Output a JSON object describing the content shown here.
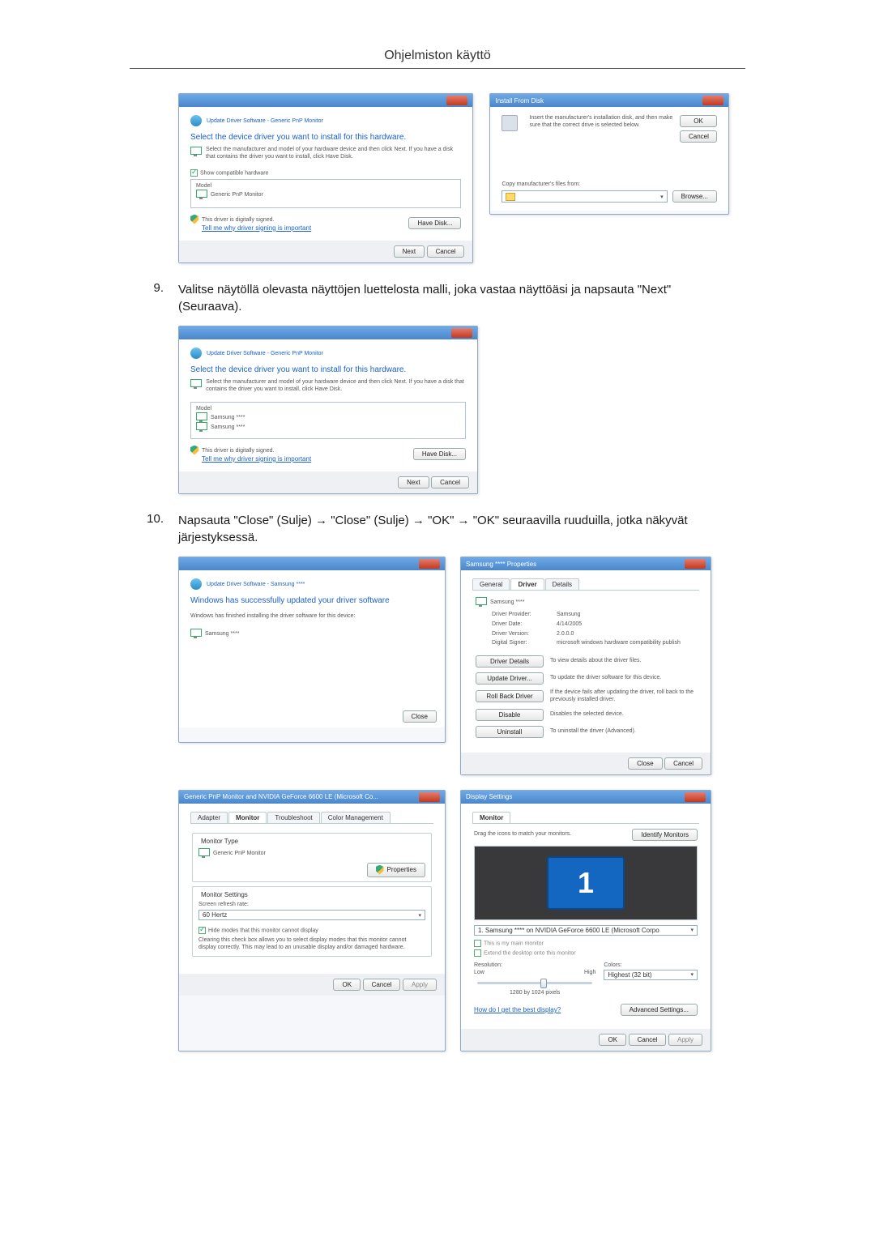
{
  "page_title": "Ohjelmiston käyttö",
  "steps": {
    "s9_num": "9.",
    "s9_text": "Valitse näytöllä olevasta näyttöjen luettelosta malli, joka vastaa näyttöäsi ja napsauta \"Next\" (Seuraava).",
    "s10_num": "10.",
    "s10_text": "Napsauta \"Close\" (Sulje) → \"Close\" (Sulje) → \"OK\" → \"OK\" seuraavilla ruuduilla, jotka näkyvät järjestyksessä."
  },
  "win_update1": {
    "breadcrumb": "Update Driver Software - Generic PnP Monitor",
    "heading": "Select the device driver you want to install for this hardware.",
    "hint": "Select the manufacturer and model of your hardware device and then click Next. If you have a disk that contains the driver you want to install, click Have Disk.",
    "show_compat": "Show compatible hardware",
    "model_label": "Model",
    "model_item": "Generic PnP Monitor",
    "signed": "This driver is digitally signed.",
    "signed_link": "Tell me why driver signing is important",
    "have_disk": "Have Disk...",
    "next": "Next",
    "cancel": "Cancel"
  },
  "win_installdisk": {
    "title": "Install From Disk",
    "instr": "Insert the manufacturer's installation disk, and then make sure that the correct drive is selected below.",
    "ok": "OK",
    "cancel": "Cancel",
    "copy": "Copy manufacturer's files from:",
    "browse": "Browse..."
  },
  "win_update2": {
    "breadcrumb": "Update Driver Software - Generic PnP Monitor",
    "heading": "Select the device driver you want to install for this hardware.",
    "hint": "Select the manufacturer and model of your hardware device and then click Next. If you have a disk that contains the driver you want to install, click Have Disk.",
    "model_label": "Model",
    "model_item1": "Samsung ****",
    "model_item2": "Samsung ****",
    "signed": "This driver is digitally signed.",
    "signed_link": "Tell me why driver signing is important",
    "have_disk": "Have Disk...",
    "next": "Next",
    "cancel": "Cancel"
  },
  "win_success": {
    "breadcrumb": "Update Driver Software - Samsung ****",
    "heading": "Windows has successfully updated your driver software",
    "sub": "Windows has finished installing the driver software for this device:",
    "device": "Samsung ****",
    "close": "Close"
  },
  "win_props": {
    "title": "Samsung **** Properties",
    "tab_general": "General",
    "tab_driver": "Driver",
    "tab_details": "Details",
    "device_name": "Samsung ****",
    "dp_label": "Driver Provider:",
    "dp_value": "Samsung",
    "dd_label": "Driver Date:",
    "dd_value": "4/14/2005",
    "dv_label": "Driver Version:",
    "dv_value": "2.0.0.0",
    "ds_label": "Digital Signer:",
    "ds_value": "microsoft windows hardware compatibility publish",
    "b_details": "Driver Details",
    "b_details_t": "To view details about the driver files.",
    "b_update": "Update Driver...",
    "b_update_t": "To update the driver software for this device.",
    "b_rollback": "Roll Back Driver",
    "b_rollback_t": "If the device fails after updating the driver, roll back to the previously installed driver.",
    "b_disable": "Disable",
    "b_disable_t": "Disables the selected device.",
    "b_uninstall": "Uninstall",
    "b_uninstall_t": "To uninstall the driver (Advanced).",
    "close": "Close",
    "cancel": "Cancel"
  },
  "win_adapter": {
    "title": "Generic PnP Monitor and NVIDIA GeForce 6600 LE (Microsoft Co...",
    "tab_adapter": "Adapter",
    "tab_monitor": "Monitor",
    "tab_trouble": "Troubleshoot",
    "tab_color": "Color Management",
    "montype_legend": "Monitor Type",
    "montype_val": "Generic PnP Monitor",
    "properties": "Properties",
    "settings_legend": "Monitor Settings",
    "refresh_label": "Screen refresh rate:",
    "refresh_val": "60 Hertz",
    "hide_modes": "Hide modes that this monitor cannot display",
    "hide_desc": "Clearing this check box allows you to select display modes that this monitor cannot display correctly. This may lead to an unusable display and/or damaged hardware.",
    "ok": "OK",
    "cancel": "Cancel",
    "apply": "Apply"
  },
  "win_display": {
    "title": "Display Settings",
    "tab_monitor": "Monitor",
    "drag": "Drag the icons to match your monitors.",
    "identify": "Identify Monitors",
    "mon_num": "1",
    "mon_select": "1. Samsung **** on NVIDIA GeForce 6600 LE (Microsoft Corpo",
    "main_mon": "This is my main monitor",
    "extend": "Extend the desktop onto this monitor",
    "res_label": "Resolution:",
    "low": "Low",
    "high": "High",
    "res_val": "1280 by 1024 pixels",
    "colors_label": "Colors:",
    "colors_val": "Highest (32 bit)",
    "best_link": "How do I get the best display?",
    "adv": "Advanced Settings...",
    "ok": "OK",
    "cancel": "Cancel",
    "apply": "Apply"
  }
}
